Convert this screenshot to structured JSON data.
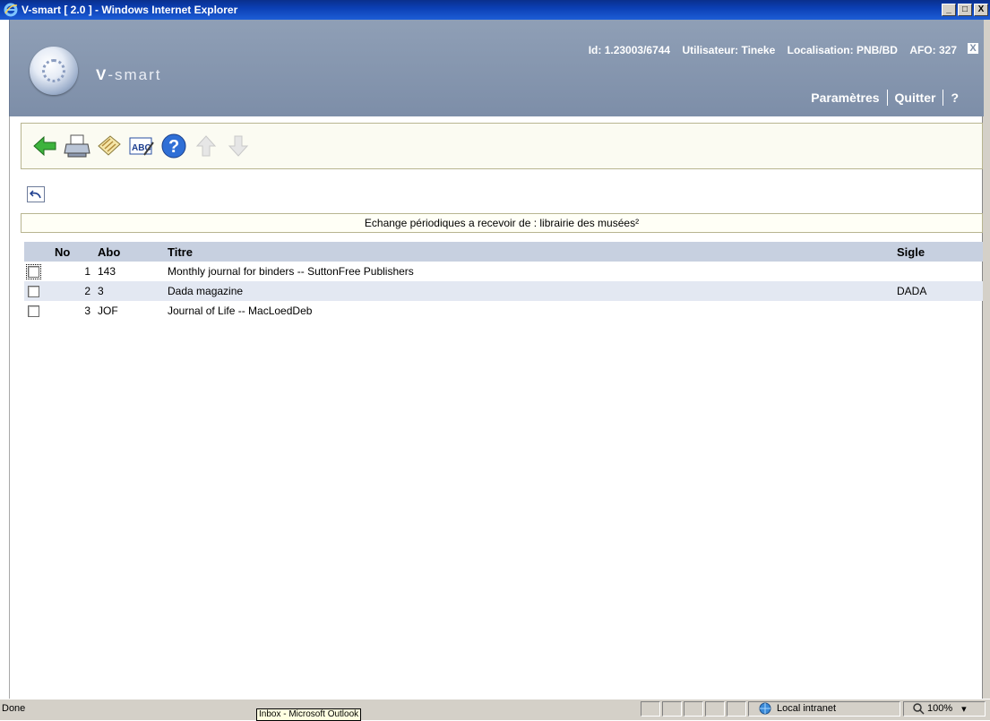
{
  "window": {
    "title": "V-smart [ 2.0 ] - Windows Internet Explorer",
    "min_label": "_",
    "max_label": "□",
    "close_label": "X"
  },
  "header": {
    "brand_v": "V",
    "brand_rest": "-smart",
    "id": "Id: 1.23003/6744",
    "user": "Utilisateur: Tineke",
    "location": "Localisation: PNB/BD",
    "afo": "AFO: 327",
    "close_label": "X",
    "links": [
      "Paramètres",
      "Quitter",
      "?"
    ]
  },
  "toolbar": {
    "icons": [
      "back-arrow-icon",
      "print-icon",
      "notes-icon",
      "spelling-icon",
      "help-icon",
      "up-arrow-icon",
      "down-arrow-icon"
    ]
  },
  "caption": "Echange périodiques a recevoir de : librairie des musées²",
  "table": {
    "headers": [
      "",
      "No",
      "Abo",
      "Titre",
      "Sigle"
    ],
    "rows": [
      {
        "no": "1",
        "abo": "143",
        "titre": "Monthly journal for binders -- SuttonFree Publishers",
        "sigle": ""
      },
      {
        "no": "2",
        "abo": "3",
        "titre": "Dada magazine",
        "sigle": "DADA"
      },
      {
        "no": "3",
        "abo": "JOF",
        "titre": "Journal of Life -- MacLoedDeb",
        "sigle": ""
      }
    ]
  },
  "statusbar": {
    "status": "Done",
    "zone": "Local intranet",
    "zoom": "100%",
    "tooltip": "Inbox - Microsoft Outlook"
  },
  "colors": {
    "header_bg": "#8f9fb6",
    "row_alt": "#e3e8f2",
    "header_row": "#c7d0e0"
  }
}
